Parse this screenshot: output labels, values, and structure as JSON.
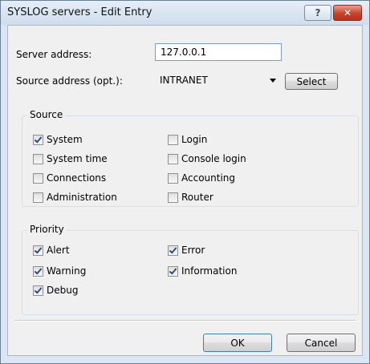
{
  "window": {
    "title": "SYSLOG servers - Edit Entry",
    "help_glyph": "?",
    "close_glyph": "✕"
  },
  "form": {
    "server_address_label": "Server address:",
    "server_address_value": "127.0.0.1",
    "source_address_label": "Source address (opt.):",
    "source_address_value": "INTRANET",
    "select_label": "Select"
  },
  "source": {
    "title": "Source",
    "items": [
      {
        "label": "System",
        "checked": true
      },
      {
        "label": "System time",
        "checked": false
      },
      {
        "label": "Connections",
        "checked": false
      },
      {
        "label": "Administration",
        "checked": false
      },
      {
        "label": "Login",
        "checked": false
      },
      {
        "label": "Console login",
        "checked": false
      },
      {
        "label": "Accounting",
        "checked": false
      },
      {
        "label": "Router",
        "checked": false
      }
    ]
  },
  "priority": {
    "title": "Priority",
    "items": [
      {
        "label": "Alert",
        "checked": true
      },
      {
        "label": "Warning",
        "checked": true
      },
      {
        "label": "Debug",
        "checked": true
      },
      {
        "label": "Error",
        "checked": true
      },
      {
        "label": "Information",
        "checked": true
      }
    ]
  },
  "buttons": {
    "ok": "OK",
    "cancel": "Cancel"
  }
}
